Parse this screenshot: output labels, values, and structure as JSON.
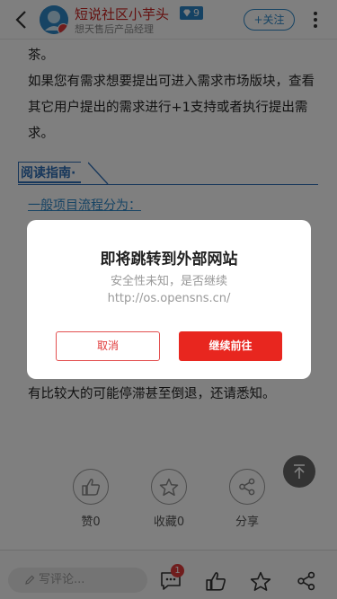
{
  "header": {
    "username": "短说社区小芋头",
    "level": "9",
    "user_title": "想天售后产品经理",
    "follow_label": "+关注"
  },
  "article": {
    "paragraphs": [
      "茶。",
      "如果您有需求想要提出可进入需求市场版块，查看其它用户提出的需求进行+1支持或者执行提出需求。"
    ],
    "guide_label": "阅读指南·",
    "flow_title": "一般项目流程分为：",
    "tail_text": "有比较大的可能停滞甚至倒退，还请悉知。"
  },
  "actions": {
    "like_label": "赞0",
    "favorite_label": "收藏0",
    "share_label": "分享"
  },
  "bottombar": {
    "comment_placeholder": "写评论...",
    "comment_count": "1"
  },
  "modal": {
    "title": "即将跳转到外部网站",
    "subtitle": "安全性未知，是否继续",
    "url": "http://os.opensns.cn/",
    "cancel_label": "取消",
    "continue_label": "继续前往"
  },
  "colors": {
    "brand_red": "#e8261f",
    "link_blue": "#2f88c9",
    "overlay": "rgba(0,0,0,0.5)"
  }
}
